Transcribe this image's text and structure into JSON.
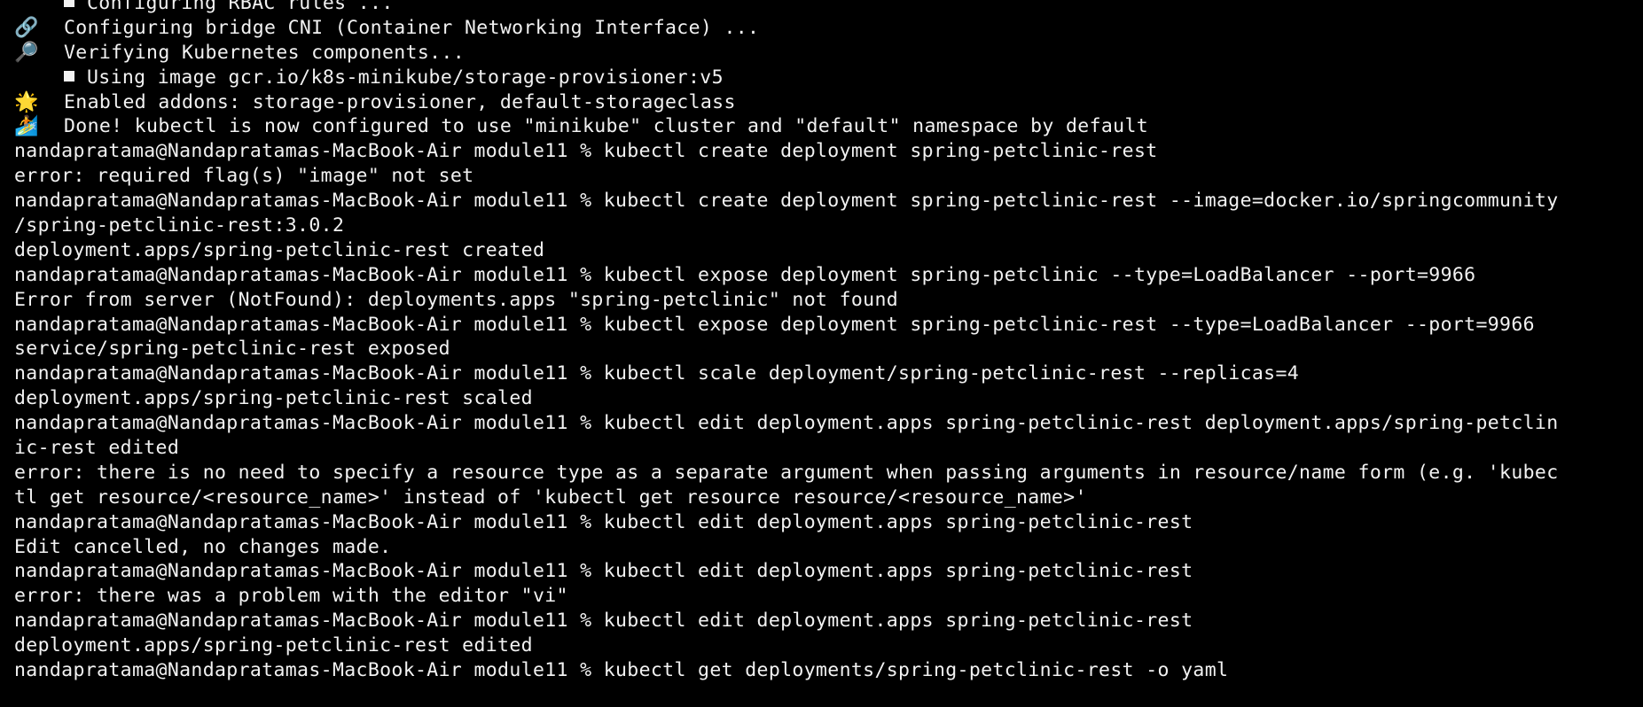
{
  "terminal": {
    "lines": [
      {
        "kind": "bullet",
        "text": "Configuring RBAC rules ..."
      },
      {
        "kind": "emoji",
        "icon": "🔗",
        "icon_name": "link-icon",
        "text": "Configuring bridge CNI (Container Networking Interface) ..."
      },
      {
        "kind": "emoji",
        "icon": "🔎",
        "icon_name": "magnifier-icon",
        "text": "Verifying Kubernetes components..."
      },
      {
        "kind": "bullet",
        "text": "Using image gcr.io/k8s-minikube/storage-provisioner:v5"
      },
      {
        "kind": "emoji",
        "icon": "🌟",
        "icon_name": "star-icon",
        "text": "Enabled addons: storage-provisioner, default-storageclass"
      },
      {
        "kind": "emoji",
        "icon": "🏄",
        "icon_name": "surfer-icon",
        "text": "Done! kubectl is now configured to use \"minikube\" cluster and \"default\" namespace by default"
      },
      {
        "kind": "plain",
        "text": "nandapratama@Nandapratamas-MacBook-Air module11 % kubectl create deployment spring-petclinic-rest"
      },
      {
        "kind": "plain",
        "text": "error: required flag(s) \"image\" not set"
      },
      {
        "kind": "plain",
        "text": "nandapratama@Nandapratamas-MacBook-Air module11 % kubectl create deployment spring-petclinic-rest --image=docker.io/springcommunity"
      },
      {
        "kind": "plain",
        "text": "/spring-petclinic-rest:3.0.2"
      },
      {
        "kind": "plain",
        "text": "deployment.apps/spring-petclinic-rest created"
      },
      {
        "kind": "plain",
        "text": "nandapratama@Nandapratamas-MacBook-Air module11 % kubectl expose deployment spring-petclinic --type=LoadBalancer --port=9966"
      },
      {
        "kind": "plain",
        "text": "Error from server (NotFound): deployments.apps \"spring-petclinic\" not found"
      },
      {
        "kind": "plain",
        "text": "nandapratama@Nandapratamas-MacBook-Air module11 % kubectl expose deployment spring-petclinic-rest --type=LoadBalancer --port=9966"
      },
      {
        "kind": "plain",
        "text": "service/spring-petclinic-rest exposed"
      },
      {
        "kind": "plain",
        "text": "nandapratama@Nandapratamas-MacBook-Air module11 % kubectl scale deployment/spring-petclinic-rest --replicas=4"
      },
      {
        "kind": "plain",
        "text": "deployment.apps/spring-petclinic-rest scaled"
      },
      {
        "kind": "plain",
        "text": "nandapratama@Nandapratamas-MacBook-Air module11 % kubectl edit deployment.apps spring-petclinic-rest deployment.apps/spring-petclin"
      },
      {
        "kind": "plain",
        "text": "ic-rest edited"
      },
      {
        "kind": "plain",
        "text": "error: there is no need to specify a resource type as a separate argument when passing arguments in resource/name form (e.g. 'kubec"
      },
      {
        "kind": "plain",
        "text": "tl get resource/<resource_name>' instead of 'kubectl get resource resource/<resource_name>'"
      },
      {
        "kind": "plain",
        "text": "nandapratama@Nandapratamas-MacBook-Air module11 % kubectl edit deployment.apps spring-petclinic-rest"
      },
      {
        "kind": "plain",
        "text": "Edit cancelled, no changes made."
      },
      {
        "kind": "plain",
        "text": "nandapratama@Nandapratamas-MacBook-Air module11 % kubectl edit deployment.apps spring-petclinic-rest"
      },
      {
        "kind": "plain",
        "text": "error: there was a problem with the editor \"vi\""
      },
      {
        "kind": "plain",
        "text": "nandapratama@Nandapratamas-MacBook-Air module11 % kubectl edit deployment.apps spring-petclinic-rest"
      },
      {
        "kind": "plain",
        "text": "deployment.apps/spring-petclinic-rest edited"
      },
      {
        "kind": "plain",
        "text": "nandapratama@Nandapratamas-MacBook-Air module11 % kubectl get deployments/spring-petclinic-rest -o yaml"
      }
    ]
  },
  "colors": {
    "background": "#000000",
    "foreground": "#f2f2f2"
  }
}
